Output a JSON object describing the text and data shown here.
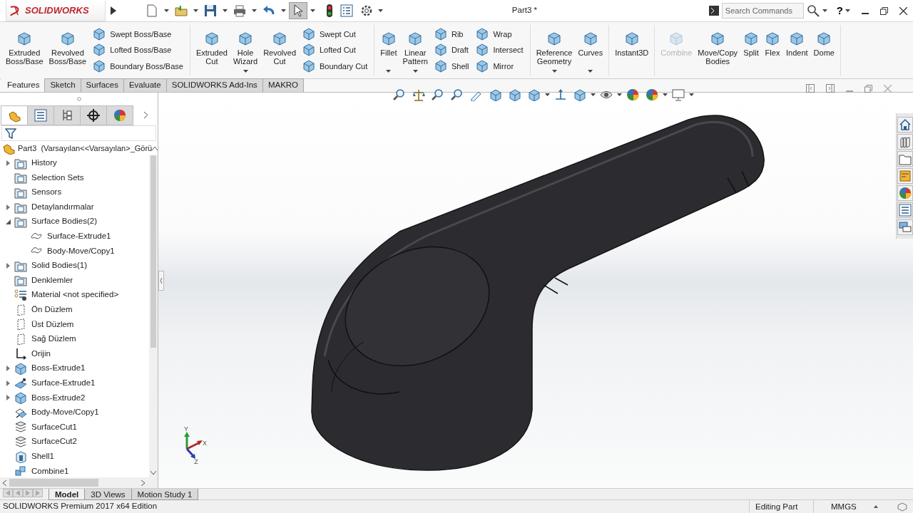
{
  "window": {
    "logo": "SOLIDWORKS",
    "title": "Part3 *",
    "search": {
      "placeholder": "Search Commands"
    },
    "help": "?"
  },
  "ribbon": {
    "groups": [
      {
        "items": [
          {
            "kind": "large",
            "label": "Extruded Boss/Base",
            "dropdown": false,
            "disabled": false
          },
          {
            "kind": "large",
            "label": "Revolved Boss/Base",
            "dropdown": false,
            "disabled": false
          },
          {
            "kind": "stack",
            "items": [
              {
                "label": "Swept Boss/Base"
              },
              {
                "label": "Lofted Boss/Base"
              },
              {
                "label": "Boundary Boss/Base"
              }
            ]
          }
        ]
      },
      {
        "items": [
          {
            "kind": "large",
            "label": "Extruded Cut",
            "dropdown": false,
            "disabled": false
          },
          {
            "kind": "large",
            "label": "Hole Wizard",
            "dropdown": true,
            "disabled": false
          },
          {
            "kind": "large",
            "label": "Revolved Cut",
            "dropdown": false,
            "disabled": false
          },
          {
            "kind": "stack",
            "items": [
              {
                "label": "Swept Cut"
              },
              {
                "label": "Lofted Cut"
              },
              {
                "label": "Boundary Cut"
              }
            ]
          }
        ]
      },
      {
        "items": [
          {
            "kind": "large",
            "label": "Fillet",
            "dropdown": true,
            "disabled": false
          },
          {
            "kind": "large",
            "label": "Linear Pattern",
            "dropdown": true,
            "disabled": false
          },
          {
            "kind": "stack",
            "items": [
              {
                "label": "Rib"
              },
              {
                "label": "Draft"
              },
              {
                "label": "Shell"
              }
            ]
          },
          {
            "kind": "stack",
            "items": [
              {
                "label": "Wrap"
              },
              {
                "label": "Intersect"
              },
              {
                "label": "Mirror"
              }
            ]
          }
        ]
      },
      {
        "items": [
          {
            "kind": "large",
            "label": "Reference Geometry",
            "dropdown": true,
            "disabled": false
          },
          {
            "kind": "large",
            "label": "Curves",
            "dropdown": true,
            "disabled": false
          }
        ]
      },
      {
        "items": [
          {
            "kind": "large",
            "label": "Instant3D",
            "dropdown": false,
            "disabled": false
          }
        ]
      },
      {
        "items": [
          {
            "kind": "large",
            "label": "Combine",
            "dropdown": false,
            "disabled": true
          },
          {
            "kind": "large",
            "label": "Move/Copy Bodies",
            "dropdown": false,
            "disabled": false
          },
          {
            "kind": "large",
            "label": "Split",
            "dropdown": false,
            "disabled": false
          },
          {
            "kind": "large",
            "label": "Flex",
            "dropdown": false,
            "disabled": false
          },
          {
            "kind": "large",
            "label": "Indent",
            "dropdown": false,
            "disabled": false
          },
          {
            "kind": "large",
            "label": "Dome",
            "dropdown": false,
            "disabled": false
          }
        ]
      }
    ]
  },
  "tabs": [
    {
      "label": "Features",
      "selected": true
    },
    {
      "label": "Sketch",
      "selected": false
    },
    {
      "label": "Surfaces",
      "selected": false
    },
    {
      "label": "Evaluate",
      "selected": false
    },
    {
      "label": "SOLIDWORKS Add-Ins",
      "selected": false
    },
    {
      "label": "MAKRO",
      "selected": false
    }
  ],
  "feature_manager": {
    "panel_tabs": [
      {
        "kind": "part",
        "selected": true
      },
      {
        "kind": "list",
        "selected": false
      },
      {
        "kind": "tree",
        "selected": false
      },
      {
        "kind": "crosshair",
        "selected": false
      },
      {
        "kind": "sphere",
        "selected": false
      }
    ],
    "tree": {
      "root": "Part3  (Varsayılan<<Varsayılan>_Görü",
      "items": [
        {
          "label": "History",
          "kind": "folder",
          "expanded": false
        },
        {
          "label": "Selection Sets",
          "kind": "folder"
        },
        {
          "label": "Sensors",
          "kind": "folder"
        },
        {
          "label": "Detaylandırmalar",
          "kind": "folder",
          "expanded": false
        },
        {
          "label": "Surface Bodies(2)",
          "kind": "folder",
          "expanded": true,
          "children": [
            {
              "label": "Surface-Extrude1",
              "kind": "surface-body"
            },
            {
              "label": "Body-Move/Copy1",
              "kind": "surface-body"
            }
          ]
        },
        {
          "label": "Solid Bodies(1)",
          "kind": "folder",
          "expanded": false
        },
        {
          "label": "Denklemler",
          "kind": "folder"
        },
        {
          "label": "Material <not specified>",
          "kind": "material"
        },
        {
          "label": "Ön Düzlem",
          "kind": "plane"
        },
        {
          "label": "Üst Düzlem",
          "kind": "plane"
        },
        {
          "label": "Sağ Düzlem",
          "kind": "plane"
        },
        {
          "label": "Orijin",
          "kind": "origin"
        },
        {
          "label": "Boss-Extrude1",
          "kind": "extrude",
          "expanded": false
        },
        {
          "label": "Surface-Extrude1",
          "kind": "surface",
          "expanded": false
        },
        {
          "label": "Boss-Extrude2",
          "kind": "extrude",
          "expanded": false
        },
        {
          "label": "Body-Move/Copy1",
          "kind": "move"
        },
        {
          "label": "SurfaceCut1",
          "kind": "cut"
        },
        {
          "label": "SurfaceCut2",
          "kind": "cut"
        },
        {
          "label": "Shell1",
          "kind": "shell"
        },
        {
          "label": "Combine1",
          "kind": "combine"
        }
      ]
    }
  },
  "graphics": {
    "triad": [
      "Y",
      "X",
      "Z"
    ]
  },
  "bottom_tabs": [
    {
      "label": "Model",
      "selected": true
    },
    {
      "label": "3D Views",
      "selected": false
    },
    {
      "label": "Motion Study 1",
      "selected": false
    }
  ],
  "status_bar": {
    "edition": "SOLIDWORKS Premium 2017 x64 Edition",
    "mode": "Editing Part",
    "units": "MMGS"
  }
}
